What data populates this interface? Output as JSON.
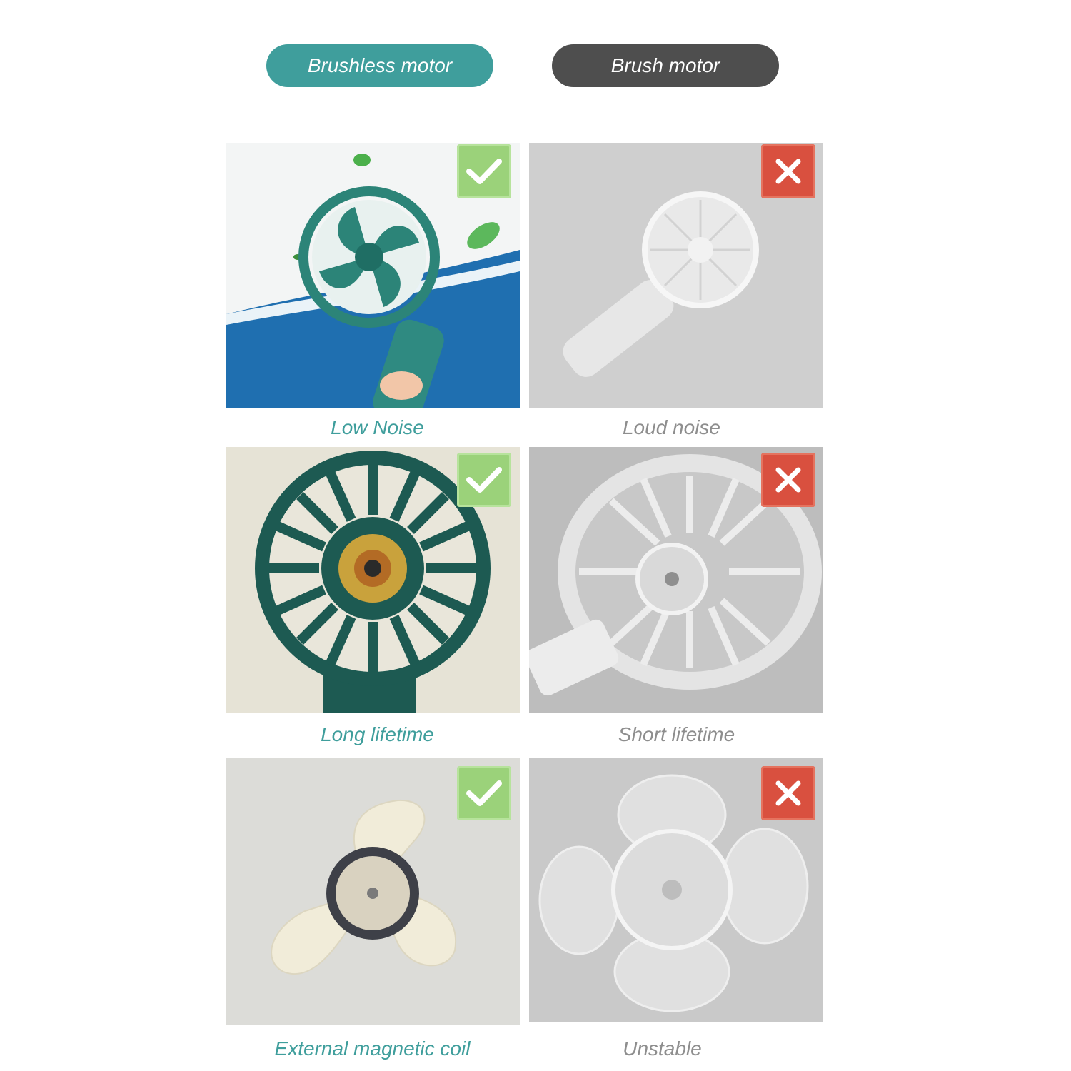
{
  "header": {
    "left_label": "Brushless motor",
    "right_label": "Brush motor"
  },
  "rows": [
    {
      "good_caption": "Low Noise",
      "bad_caption": "Loud noise"
    },
    {
      "good_caption": "Long lifetime",
      "bad_caption": "Short lifetime"
    },
    {
      "good_caption": "External magnetic coil",
      "bad_caption": "Unstable"
    }
  ],
  "colors": {
    "accent": "#3f9e9c",
    "dark_pill": "#4e4e4e",
    "check_green": "#9bd27a",
    "cross_red": "#d9503f",
    "muted_text": "#8e8e8e"
  },
  "icons": {
    "good": "check-icon",
    "bad": "cross-icon"
  }
}
